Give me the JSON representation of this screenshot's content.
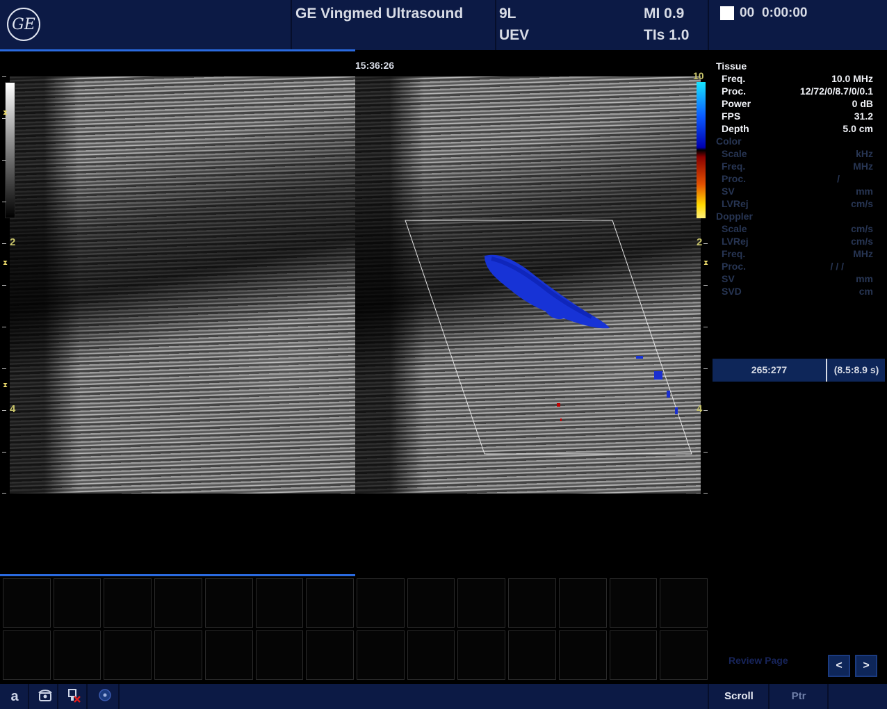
{
  "header": {
    "logo": "GE",
    "vendor": "GE Vingmed Ultrasound",
    "probe": "9L",
    "preset": "UEV",
    "mi": "MI 0.9",
    "tis": "TIs 1.0",
    "cine_index": "00",
    "cine_clock": "0:00:00"
  },
  "image": {
    "timestamp": "15:36:26",
    "depth_labels": {
      "top": "2",
      "bottom": "4"
    },
    "color_scale_label": "10",
    "color_map_colors": [
      "#17e6ff",
      "#0b5bff",
      "#0000b0",
      "#8a0000",
      "#e35000",
      "#ffd800"
    ]
  },
  "panel": {
    "tissue": {
      "title": "Tissue",
      "rows": [
        {
          "label": "Freq.",
          "value": "10.0  MHz"
        },
        {
          "label": "Proc.",
          "value": "12/72/0/8.7/0/0.1"
        },
        {
          "label": "Power",
          "value": "0  dB"
        },
        {
          "label": "FPS",
          "value": "31.2"
        },
        {
          "label": "Depth",
          "value": "5.0  cm"
        }
      ]
    },
    "color": {
      "title": "Color",
      "rows": [
        {
          "label": "Scale",
          "value": "kHz"
        },
        {
          "label": "Freq.",
          "value": "MHz"
        },
        {
          "label": "Proc.",
          "value": "/"
        },
        {
          "label": "SV",
          "value": "mm"
        },
        {
          "label": "LVRej",
          "value": "cm/s"
        }
      ]
    },
    "doppler": {
      "title": "Doppler",
      "rows": [
        {
          "label": "Scale",
          "value": "cm/s"
        },
        {
          "label": "LVRej",
          "value": "cm/s"
        },
        {
          "label": "Freq.",
          "value": "MHz"
        },
        {
          "label": "Proc.",
          "value": "/ / /"
        },
        {
          "label": "SV",
          "value": "mm"
        },
        {
          "label": "SVD",
          "value": "cm"
        }
      ]
    }
  },
  "cine": {
    "frames": "265:277",
    "time_range": "(8.5:8.9 s)"
  },
  "review": {
    "label": "Review Page",
    "prev": "<",
    "next": ">"
  },
  "taskbar": {
    "icons": [
      "a-icon",
      "phone-icon",
      "network-error-icon",
      "disc-icon"
    ],
    "a_label": "a",
    "scroll_label": "Scroll",
    "ptr_label": "Ptr"
  }
}
